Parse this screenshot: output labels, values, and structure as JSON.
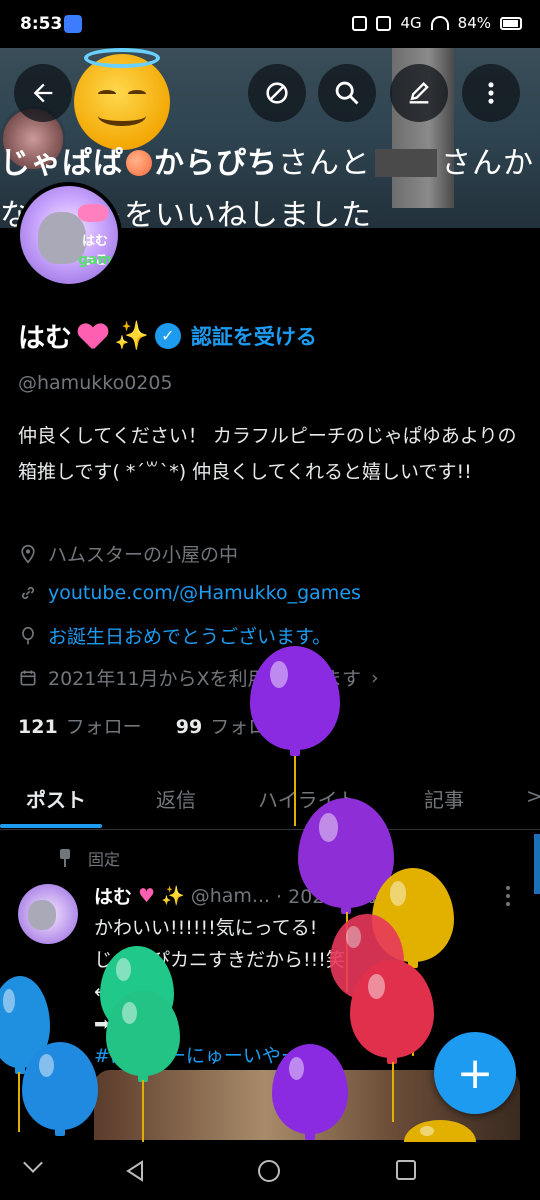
{
  "status_bar": {
    "time": "8:53",
    "network": "4G",
    "battery": "84%"
  },
  "banner": {
    "line1_a": "じゃぱぱ",
    "line1_b": "からぴち",
    "line1_c": "さんと",
    "line1_d": "さんか",
    "line2": "なポストをいいねしました"
  },
  "profile": {
    "avatar_text": "はむっこ",
    "avatar_games": "games",
    "name": "はむ",
    "verify_link": "認証を受ける",
    "handle": "@hamukko0205",
    "bio": "仲良くしてください！ カラフルピーチのじゃぱゆあよりの箱推しです( *´꒳`*) 仲良くしてくれると嬉しいです!!",
    "location": "ハムスターの小屋の中",
    "website": "youtube.com/@Hamukko_games",
    "birthday": "お誕生日おめでとうございます。",
    "joined": "2021年11月からXを利用しています",
    "following_count": "121",
    "following_label": "フォロー",
    "followers_count": "99",
    "followers_label": "フォロワー"
  },
  "tabs": [
    {
      "label": "ポスト"
    },
    {
      "label": "返信"
    },
    {
      "label": "ハイライト"
    },
    {
      "label": "記事"
    },
    {
      "label": ">"
    }
  ],
  "post": {
    "pinned_label": "固定",
    "author_name": "はむ",
    "author_handle": "@ham...",
    "date": "· 2025年01月02日",
    "line1": "かわいい!!!!!!気にってる!",
    "line2": "じゃっぴカニすきだから!!!笑",
    "line3": "←虎",
    "line4": "➡",
    "hashtag": "#はっぴーにゅーいやー"
  },
  "fab": {
    "label": "+"
  },
  "colors": {
    "accent": "#1d9bf0",
    "background": "#000000",
    "muted_text": "#71767b"
  },
  "icons": [
    "back-arrow-icon",
    "no-sign-icon",
    "search-icon",
    "edit-icon",
    "more-icon",
    "location-icon",
    "link-icon",
    "balloon-icon",
    "calendar-icon",
    "pin-icon"
  ]
}
